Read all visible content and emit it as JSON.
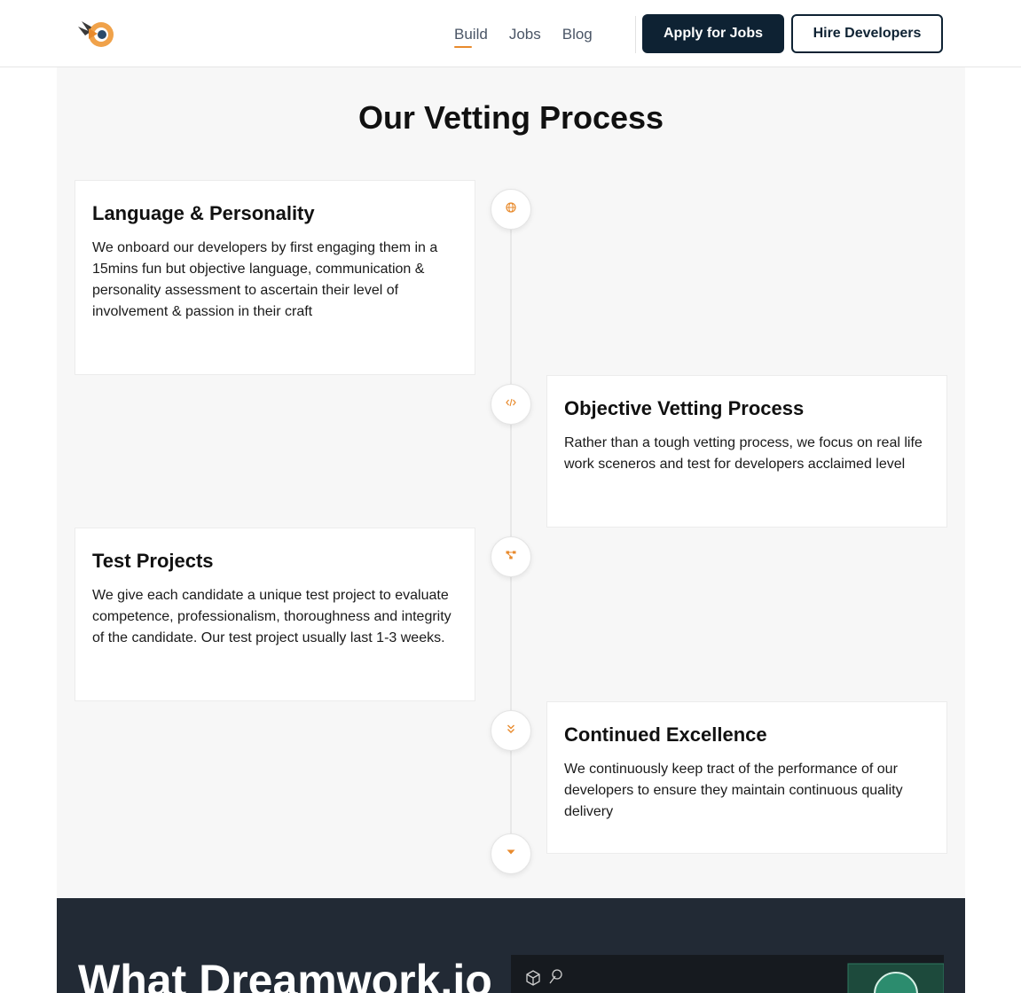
{
  "nav": {
    "links": [
      {
        "label": "Build",
        "active": true
      },
      {
        "label": "Jobs",
        "active": false
      },
      {
        "label": "Blog",
        "active": false
      }
    ],
    "apply_label": "Apply for Jobs",
    "hire_label": "Hire Developers"
  },
  "colors": {
    "brand_dark": "#0e2233",
    "accent_orange": "#e88a2c",
    "section_bg": "#f7f7f7",
    "dark_bg": "#222a35"
  },
  "vetting": {
    "title": "Our Vetting Process",
    "steps": [
      {
        "title": "Language & Personality",
        "description": "We onboard our developers by first engaging them in a 15mins fun but objective language, communication & personality assessment to ascertain their level of involvement & passion in their craft",
        "icon": "globe-icon"
      },
      {
        "title": "Objective Vetting Process",
        "description": "Rather than a tough vetting process, we focus on real life work sceneros and test for developers acclaimed level",
        "icon": "code-icon"
      },
      {
        "title": "Test Projects",
        "description": "We give each candidate a unique test project to evaluate competence, professionalism, thoroughness and integrity of the candidate. Our test project usually last 1-3 weeks.",
        "icon": "sitemap-icon"
      },
      {
        "title": "Continued Excellence",
        "description": "We continuously keep tract of the performance of our developers to ensure they maintain continuous quality delivery",
        "icon": "double-chevron-down-icon"
      }
    ],
    "end_icon": "caret-down-icon"
  },
  "next_section": {
    "heading": "What Dreamwork.io"
  }
}
